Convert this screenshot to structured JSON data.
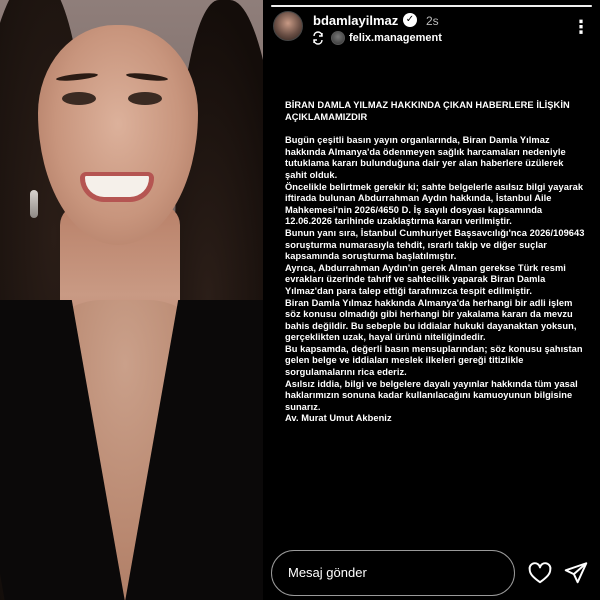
{
  "header": {
    "username": "bdamlayilmaz",
    "time": "2s",
    "collaborator": "felix.management",
    "icons": {
      "verified": "verified-badge-icon",
      "more": "more-options-icon",
      "collab": "repost-icon"
    }
  },
  "statement": {
    "title": "BİRAN DAMLA YILMAZ HAKKINDA ÇIKAN HABERLERE İLİŞKİN AÇIKLAMAMIZDIR",
    "paragraphs": [
      "Bugün çeşitli basın yayın organlarında, Biran Damla Yılmaz hakkında Almanya'da ödenmeyen sağlık harcamaları nedeniyle tutuklama kararı bulunduğuna dair yer alan haberlere üzülerek şahit olduk.",
      "Öncelikle belirtmek gerekir ki; sahte belgelerle asılsız bilgi yayarak iftirada bulunan Abdurrahman Aydın hakkında, İstanbul Aile Mahkemesi'nin 2026/4650 D. İş sayılı dosyası kapsamında 12.06.2026 tarihinde uzaklaştırma kararı verilmiştir.",
      "Bunun yanı sıra, İstanbul Cumhuriyet Başsavcılığı'nca 2026/109643 soruşturma numarasıyla tehdit, ısrarlı takip ve diğer suçlar kapsamında soruşturma başlatılmıştır.",
      "Ayrıca, Abdurrahman Aydın'ın gerek Alman gerekse Türk resmi evrakları üzerinde tahrif ve sahtecilik yaparak Biran Damla Yılmaz'dan para talep ettiği tarafımızca tespit edilmiştir.",
      "Biran Damla Yılmaz hakkında Almanya'da herhangi bir adli işlem söz konusu olmadığı gibi herhangi bir yakalama kararı da mevzu bahis değildir. Bu sebeple bu iddialar hukuki dayanaktan yoksun, gerçeklikten uzak, hayal ürünü niteliğindedir.",
      "Bu kapsamda, değerli basın mensuplarından; söz konusu şahıstan gelen belge ve iddiaları meslek ilkeleri gereği titizlikle sorgulamalarını rica ederiz.",
      "Asılsız iddia, bilgi ve belgelere dayalı yayınlar hakkında tüm yasal haklarımızın sonuna kadar kullanılacağını kamuoyunun bilgisine sunarız."
    ],
    "signature": "Av. Murat Umut Akbeniz"
  },
  "footer": {
    "reply_placeholder": "Mesaj gönder",
    "icons": {
      "like": "heart-icon",
      "send": "send-icon"
    }
  }
}
